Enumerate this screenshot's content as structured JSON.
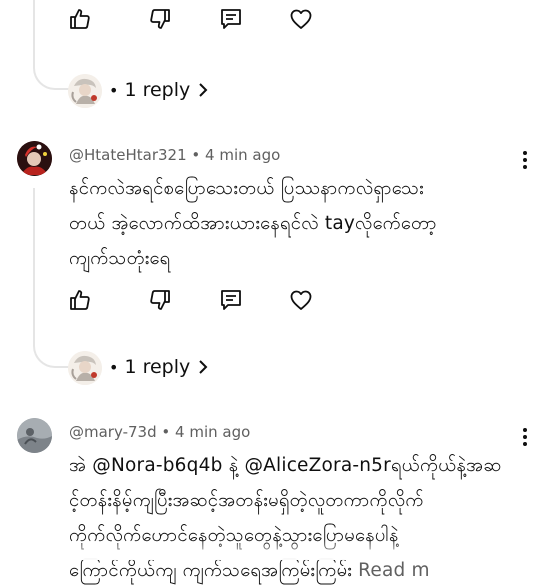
{
  "colors": {
    "text": "#0f0f0f",
    "meta": "#606060",
    "thread_line": "#e5e5e5"
  },
  "thread1": {
    "actions": [
      "like-icon",
      "dislike-icon",
      "comment-icon",
      "heart-icon"
    ],
    "replies_label": "1 reply"
  },
  "comment1": {
    "username": "@HtateHtar321",
    "separator": "•",
    "time": "4 min ago",
    "lines": [
      "နင်ကလဲအရင်စပြောသေးတယ် ပြဿနာကလဲရှာသေး",
      "တယ် အဲ့လောက်ထိအားယားနေရင်လဲ tayလိုက်ေတော့",
      "ကျက်သတုံးရေ"
    ],
    "actions": [
      "like-icon",
      "dislike-icon",
      "comment-icon",
      "heart-icon"
    ],
    "replies_label": "1 reply"
  },
  "comment2": {
    "username": "@mary-73d",
    "separator": "•",
    "time": "4 min ago",
    "line1_prefix": "အဲ ",
    "mention1": "@Nora-b6q4b",
    "line1_mid": " နဲ့ ",
    "mention2": "@AliceZora-n5r",
    "line1_suffix": "ရယ်ကိုယ်နဲ့အဆ",
    "line2": "င့်တန်းနိမ့်ကျပြီးအဆင့်အတန်းမရှိတဲ့လူတကာကိုလိုက်",
    "line3": "ကိုက်လိုက်ဟောင်နေတဲ့သူတွေနဲ့သွားပြောမနေပါနဲ့",
    "line4": "ကြောင်ကိုယ်ကျ ကျက်သရေအကြမ်းကြမ်း",
    "read_more": "Read m"
  }
}
